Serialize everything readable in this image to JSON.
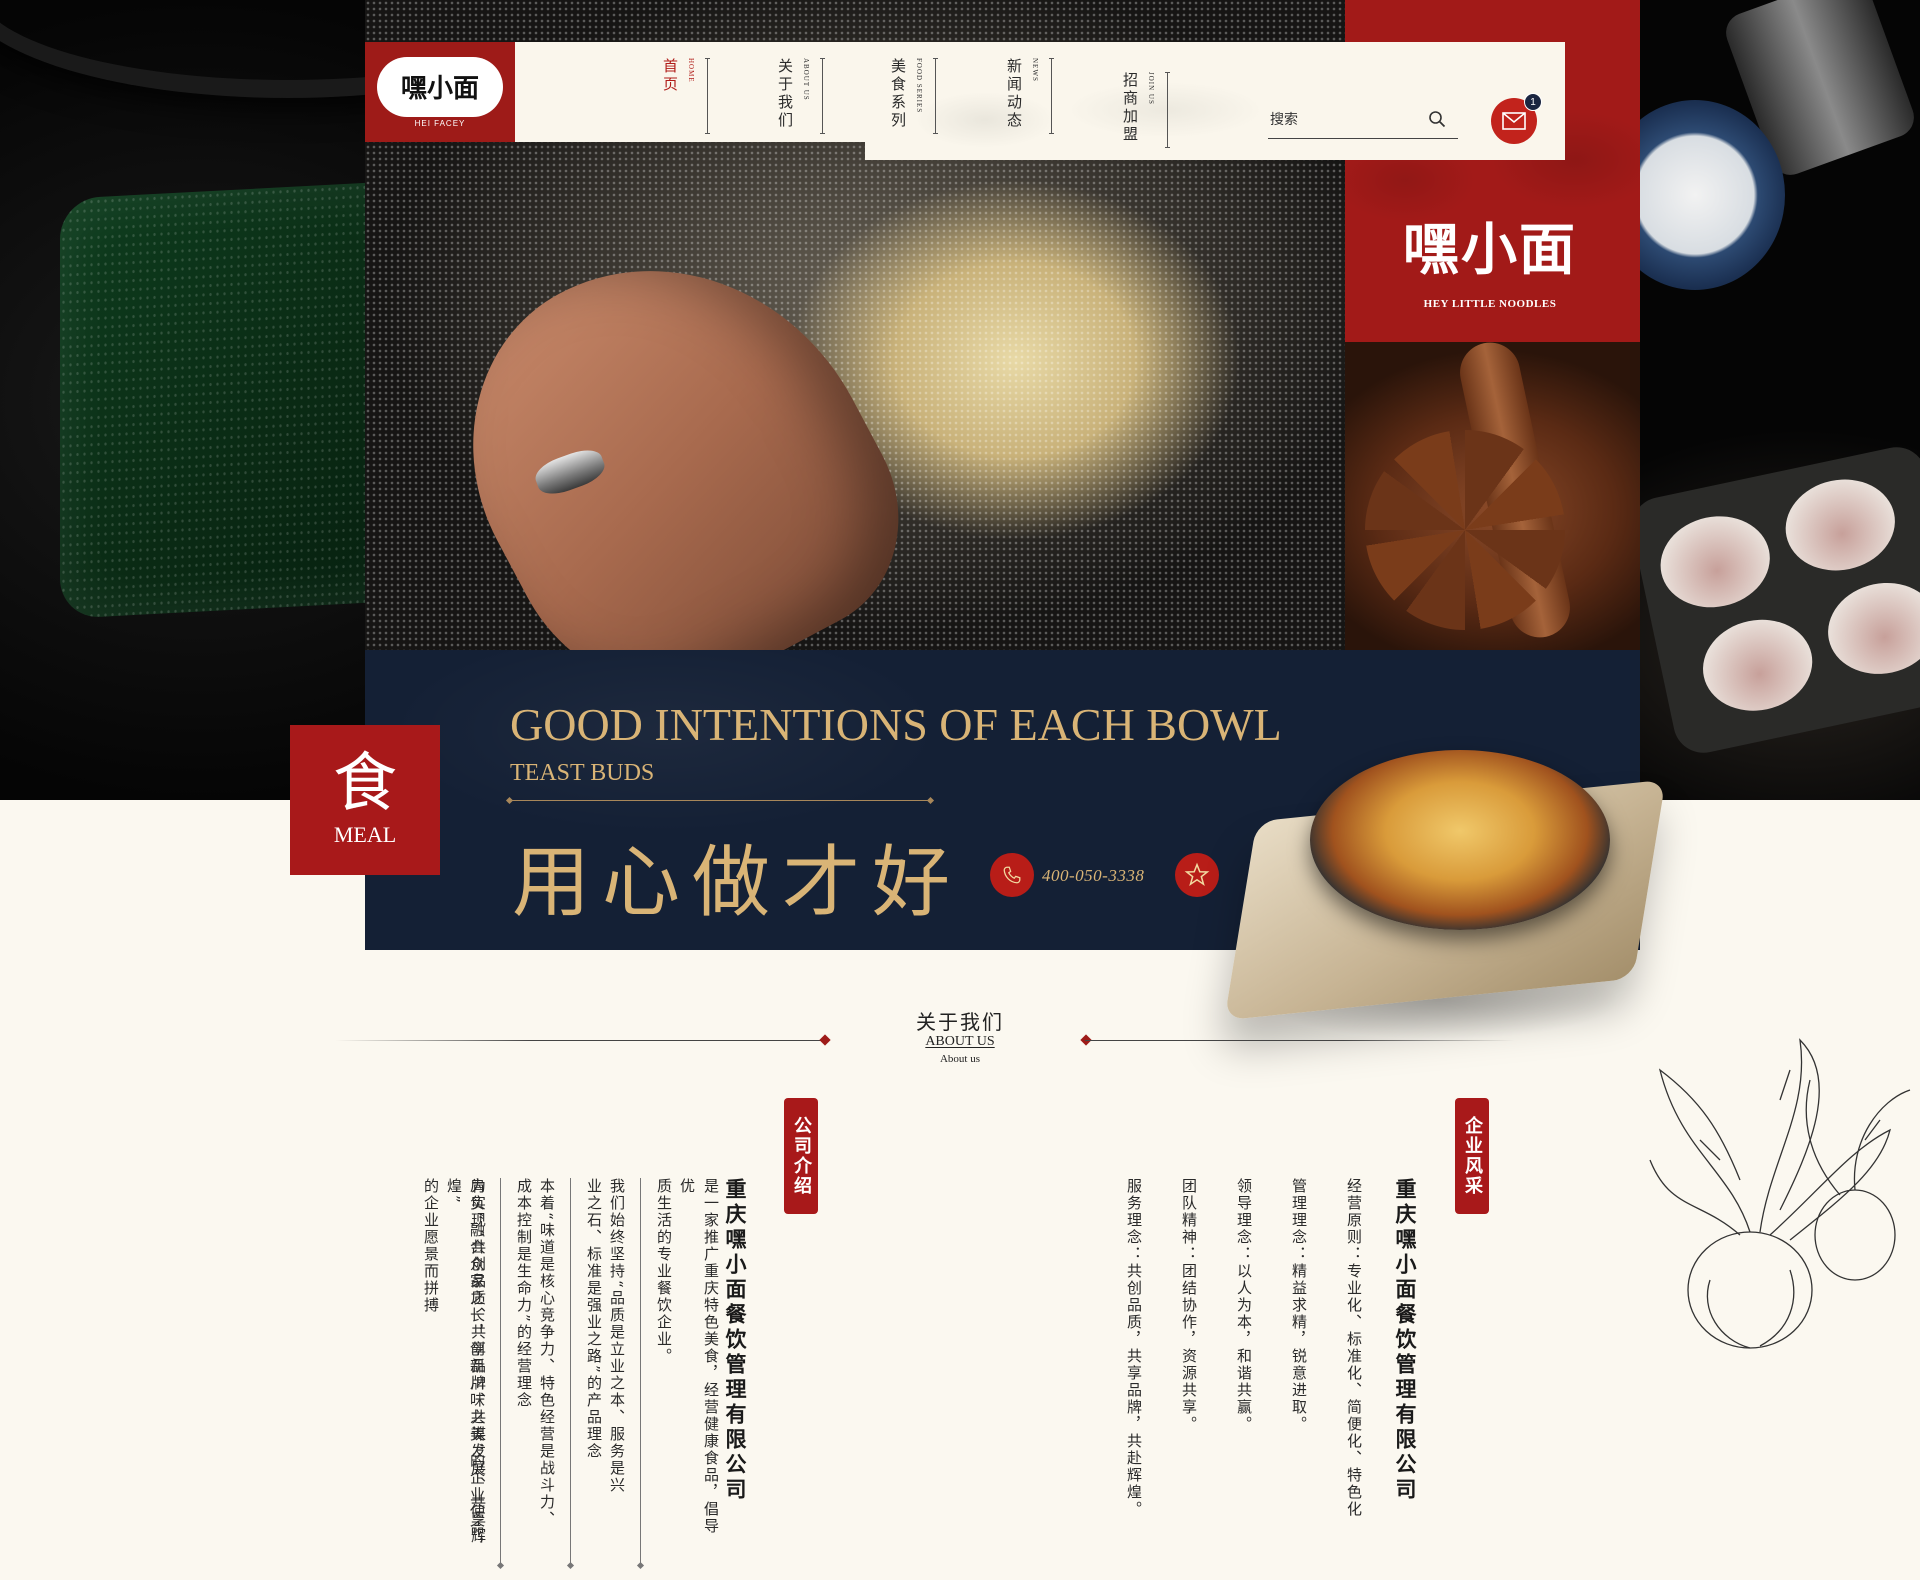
{
  "logo": {
    "text": "嘿小面",
    "sub": "HEI FACEY"
  },
  "nav": {
    "items": [
      {
        "cn": "首页",
        "en": "HOME",
        "active": true
      },
      {
        "cn": "关于我们",
        "en": "ABOUT US",
        "active": false
      },
      {
        "cn": "美食系列",
        "en": "FOOD SERIES",
        "active": false
      },
      {
        "cn": "新闻动态",
        "en": "NEWS",
        "active": false
      },
      {
        "cn": "招商加盟",
        "en": "JOIN US",
        "active": false
      }
    ]
  },
  "search": {
    "placeholder": "搜索"
  },
  "mail": {
    "badge_count": "1"
  },
  "brand": {
    "cn": "嘿小面",
    "en": "HEY LITTLE NOODLES"
  },
  "banner": {
    "title": "GOOD INTENTIONS OF EACH BOWL",
    "subtitle": "TEAST BUDS",
    "slogan": "用心做才好",
    "phone": "400-050-3338",
    "meal_cn": "食",
    "meal_en": "MEAL"
  },
  "about": {
    "title_cn": "关于我们",
    "title_en": "ABOUT US",
    "title_en_small": "About us",
    "company_intro": {
      "seal": "公司介绍",
      "heading": "重庆嘿小面餐饮管理有限公司",
      "paragraphs": [
        "是一家推广重庆特色美食，经营健康食品，倡导优",
        "质生活的专业餐饮企业。",
        "我们始终坚持“品质是立业之本、服务是兴",
        "业之石、标准是强业之路”的产品理念",
        "本着“味道是核心竞争力、特色经营是战斗力、",
        "成本控制是生命力”的经营理念",
        "肩负“融合众家之长，创新川味之美”的企业使命，",
        "为实现“共创品质、共享品牌、共谋发展、共享辉煌”",
        "的企业愿景而拼搏"
      ]
    },
    "corporate_style": {
      "seal": "企业风采",
      "heading": "重庆嘿小面餐饮管理有限公司",
      "paragraphs": [
        "经营原则：专业化、标准化、简便化、特色化",
        "管理理念：精益求精，锐意进取。",
        "领导理念：以人为本，和谐共赢。",
        "团队精神：团结协作，资源共享。",
        "服务理念：共创品质，共享品牌，共赴辉煌。"
      ]
    }
  },
  "colors": {
    "brand_red": "#a21a18",
    "navy": "#142035",
    "gold": "#d9b476",
    "cream": "#fbf8f0"
  }
}
